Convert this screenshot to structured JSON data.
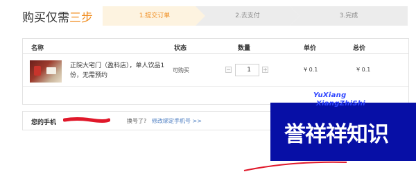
{
  "header": {
    "title_main": "购买仅需",
    "title_accent": "三步"
  },
  "steps": [
    {
      "label": "1.提交订单",
      "active": true
    },
    {
      "label": "2.去支付",
      "active": false
    },
    {
      "label": "3.完成",
      "active": false
    }
  ],
  "colors": {
    "accent": "#f08c1e",
    "active_step_bg": "#fdf3e0",
    "inactive_step_bg": "#ececec",
    "link": "#4d7ec2",
    "watermark_bg": "#070fa6"
  },
  "table": {
    "headers": {
      "name": "名称",
      "status": "状态",
      "quantity": "数量",
      "unit_price": "单价",
      "total": "总价"
    },
    "rows": [
      {
        "product_title": "正院大宅门（盈科店），单人饮品1份，无需预约",
        "status": "可购买",
        "quantity": "1",
        "unit_price": "¥ 0.1",
        "total_price": "¥ 0.1"
      }
    ]
  },
  "phone": {
    "label": "您的手机",
    "changed_prompt": "换号了?",
    "change_link": "修改绑定手机号 >>"
  },
  "watermark": {
    "line1": "YuXiang",
    "line2": "XiangZhiShi",
    "cjk": "誉祥祥知识"
  }
}
